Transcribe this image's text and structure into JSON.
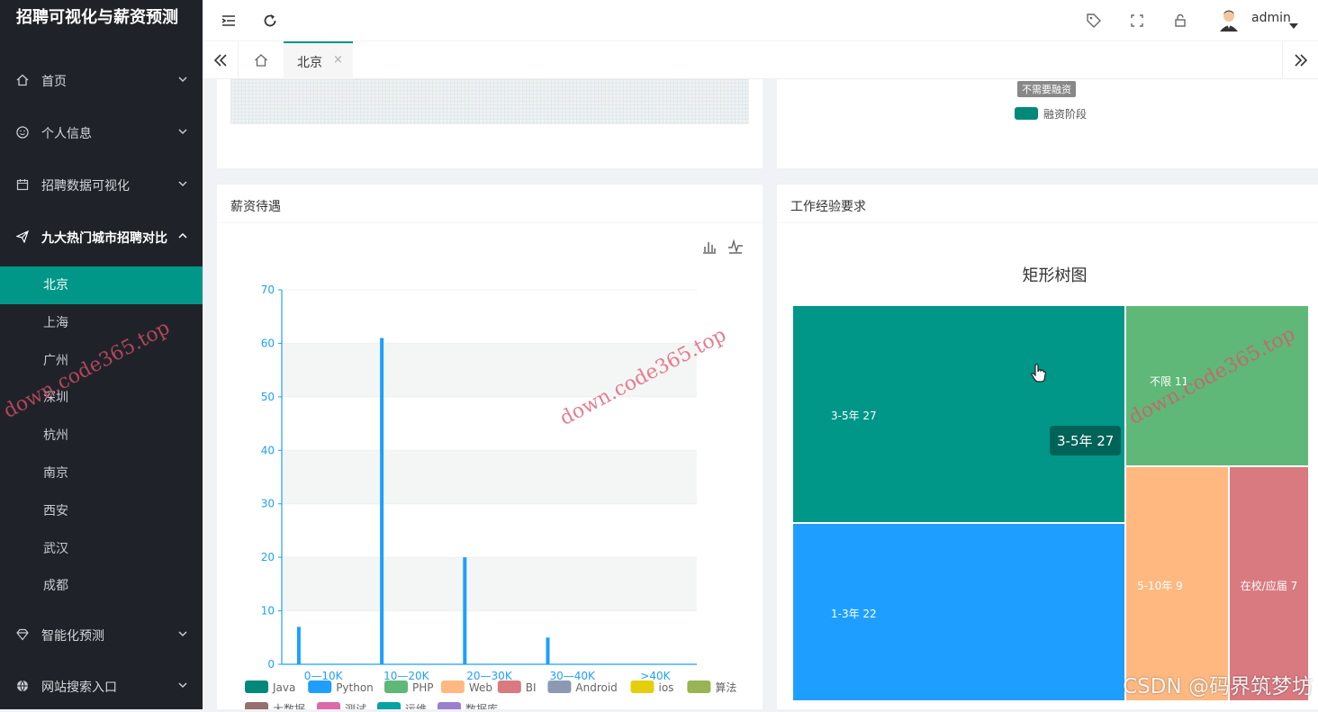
{
  "app_title": "招聘可视化与薪资预测",
  "sidebar": {
    "menus": [
      {
        "label": "首页",
        "icon": "home-icon"
      },
      {
        "label": "个人信息",
        "icon": "smile-icon"
      },
      {
        "label": "招聘数据可视化",
        "icon": "calendar-icon"
      },
      {
        "label": "九大热门城市招聘对比",
        "icon": "send-icon"
      },
      {
        "label": "智能化预测",
        "icon": "diamond-icon"
      },
      {
        "label": "网站搜索入口",
        "icon": "globe-icon"
      }
    ],
    "cities": [
      "北京",
      "上海",
      "广州",
      "深圳",
      "杭州",
      "南京",
      "西安",
      "武汉",
      "成都"
    ],
    "active_city": "北京"
  },
  "header": {
    "user": "admin",
    "icons": [
      "menu-fold-icon",
      "refresh-icon",
      "tag-icon",
      "fullscreen-icon",
      "lock-icon"
    ]
  },
  "tabs": {
    "home_icon": "home-icon",
    "items": [
      {
        "label": "北京",
        "close": "×"
      }
    ]
  },
  "top_right_card": {
    "tooltip": "不需要融资",
    "legend": "融资阶段",
    "legend_color": "#00897b"
  },
  "salary_chart": {
    "card_title": "薪资待遇",
    "chart_data": {
      "type": "bar",
      "categories": [
        "0—10K",
        "10—20K",
        "20—30K",
        "30—40K",
        ">40K"
      ],
      "series": [
        {
          "name": "Java",
          "color": "#00897b",
          "values": [
            0,
            0,
            0,
            0,
            0
          ]
        },
        {
          "name": "Python",
          "color": "#1e9fff",
          "values": [
            7,
            61,
            20,
            5,
            0
          ]
        },
        {
          "name": "PHP",
          "color": "#5fb878",
          "values": [
            0,
            0,
            0,
            0,
            0
          ]
        },
        {
          "name": "Web",
          "color": "#ffb980",
          "values": [
            0,
            0,
            0,
            0,
            0
          ]
        },
        {
          "name": "BI",
          "color": "#d87a80",
          "values": [
            0,
            0,
            0,
            0,
            0
          ]
        },
        {
          "name": "Android",
          "color": "#8d98b3",
          "values": [
            0,
            0,
            0,
            0,
            0
          ]
        },
        {
          "name": "ios",
          "color": "#e5cf0d",
          "values": [
            0,
            0,
            0,
            0,
            0
          ]
        },
        {
          "name": "算法",
          "color": "#97b552",
          "values": [
            0,
            0,
            0,
            0,
            0
          ]
        },
        {
          "name": "大数据",
          "color": "#95706d",
          "values": [
            0,
            0,
            0,
            0,
            0
          ]
        },
        {
          "name": "测试",
          "color": "#dc69aa",
          "values": [
            0,
            0,
            0,
            0,
            0
          ]
        },
        {
          "name": "运维",
          "color": "#07a2a4",
          "values": [
            0,
            0,
            0,
            0,
            0
          ]
        },
        {
          "name": "数据库",
          "color": "#9a7fd1",
          "values": [
            0,
            0,
            0,
            0,
            0
          ]
        }
      ],
      "yticks": [
        "0",
        "10",
        "20",
        "30",
        "40",
        "50",
        "60",
        "70"
      ],
      "ylim": [
        0,
        70
      ],
      "legend_position": "bottom"
    }
  },
  "experience_chart": {
    "card_title": "工作经验要求",
    "chart_data": {
      "type": "treemap",
      "title": "矩形树图",
      "items": [
        {
          "name": "3-5年",
          "value": 27,
          "label": "3-5年 27",
          "color": "#009688"
        },
        {
          "name": "1-3年",
          "value": 22,
          "label": "1-3年 22",
          "color": "#1e9fff"
        },
        {
          "name": "不限",
          "value": 11,
          "label": "不限 11",
          "color": "#5fb878"
        },
        {
          "name": "5-10年",
          "value": 9,
          "label": "5-10年 9",
          "color": "#ffb980"
        },
        {
          "name": "在校/应届",
          "value": 7,
          "label": "在校/应届 7",
          "color": "#d87a80"
        }
      ],
      "tooltip": "3-5年 27"
    }
  },
  "watermark": "down.code365.top",
  "footer_mark": "CSDN @码界筑梦坊"
}
